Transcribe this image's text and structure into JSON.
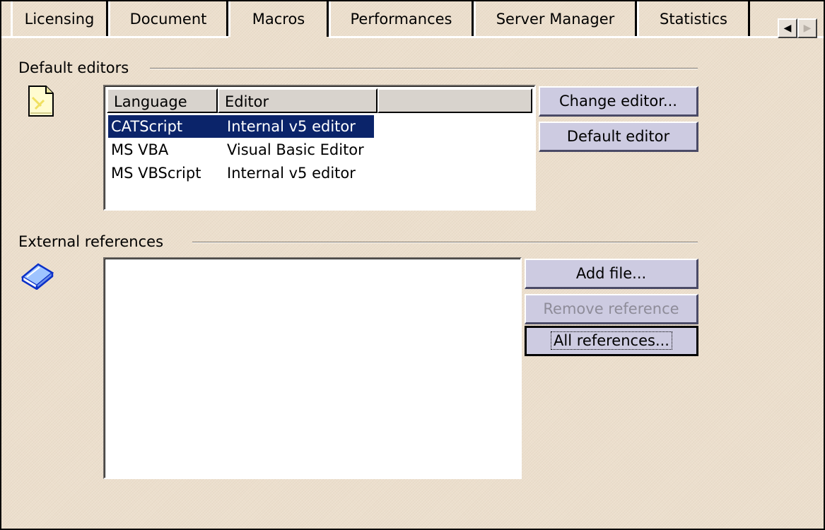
{
  "tabs": [
    {
      "label": "Licensing",
      "active": false
    },
    {
      "label": "Document",
      "active": false
    },
    {
      "label": "Macros",
      "active": true
    },
    {
      "label": "Performances",
      "active": false
    },
    {
      "label": "Server Manager",
      "active": false
    },
    {
      "label": "Statistics",
      "active": false
    }
  ],
  "tab_scroll": {
    "left_icon": "triangle-left-icon",
    "right_icon": "triangle-right-icon"
  },
  "default_editors": {
    "heading": "Default editors",
    "icon": "document-icon",
    "columns": [
      "Language",
      "Editor",
      ""
    ],
    "rows": [
      {
        "language": "CATScript",
        "editor": "Internal v5 editor",
        "selected": true
      },
      {
        "language": "MS VBA",
        "editor": "Visual Basic Editor",
        "selected": false
      },
      {
        "language": "MS VBScript",
        "editor": "Internal v5 editor",
        "selected": false
      }
    ],
    "buttons": {
      "change_editor": "Change editor...",
      "default_editor": "Default editor"
    }
  },
  "external_references": {
    "heading": "External references",
    "icon": "book-icon",
    "items": [],
    "buttons": {
      "add_file": "Add file...",
      "remove_reference": "Remove reference",
      "all_references": "All references..."
    }
  },
  "colors": {
    "background": "#ecdfcd",
    "selection": "#0b246a",
    "button_face": "#cdcbe1"
  }
}
